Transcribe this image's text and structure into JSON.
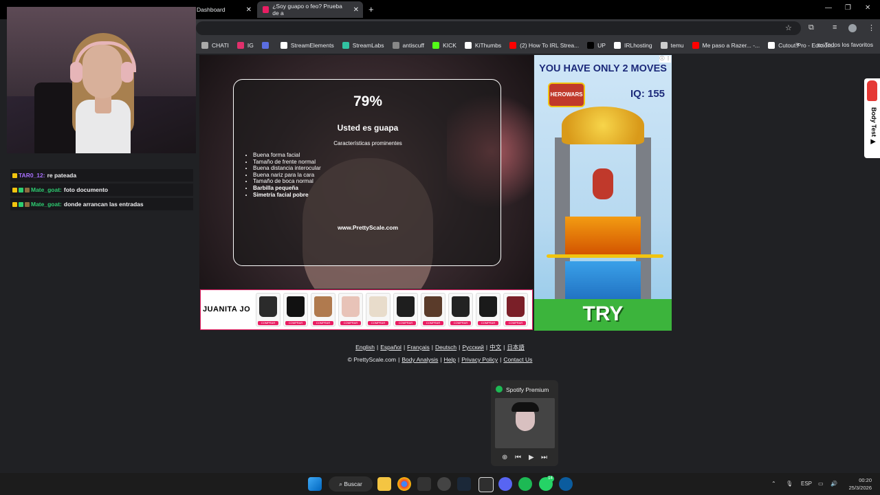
{
  "tabs": [
    {
      "title": "Dashboard"
    },
    {
      "title": "¿Soy guapo o feo? Prueba de a"
    }
  ],
  "bookmarks": [
    {
      "label": "CHATI",
      "color": "#aaaaaa"
    },
    {
      "label": "IG",
      "color": "#e1306c"
    },
    {
      "label": "",
      "color": "#5b6ee1"
    },
    {
      "label": "StreamElements",
      "color": "#ffffff"
    },
    {
      "label": "StreamLabs",
      "color": "#31c3a2"
    },
    {
      "label": "antiscuff",
      "color": "#888888"
    },
    {
      "label": "KICK",
      "color": "#53fc18"
    },
    {
      "label": "KiThumbs",
      "color": "#ffffff"
    },
    {
      "label": "(2) How To IRL Strea...",
      "color": "#ff0000"
    },
    {
      "label": "UP",
      "color": "#000000"
    },
    {
      "label": "IRLhosting",
      "color": "#ffffff"
    },
    {
      "label": "temu",
      "color": "#cccccc"
    },
    {
      "label": "Me paso a Razer... -...",
      "color": "#ff0000"
    },
    {
      "label": "Cutout.Pro - Edición...",
      "color": "#ffffff"
    }
  ],
  "all_favorites": "Todos los favoritos",
  "chat": [
    {
      "user": "TAR0_12:",
      "user_color": "#a970ff",
      "message": "re pateada"
    },
    {
      "user": "Mate_goat:",
      "user_color": "#2ecc71",
      "message": "foto documento"
    },
    {
      "user": "Mate_goat:",
      "user_color": "#2ecc71",
      "message": "donde arrancan las entradas"
    }
  ],
  "result": {
    "percent": "79%",
    "verdict": "Usted es guapa",
    "features_title": "Características prominentes",
    "features": [
      {
        "text": "Buena forma facial",
        "bold": false
      },
      {
        "text": "Tamaño de frente normal",
        "bold": false
      },
      {
        "text": "Buena distancia interocular",
        "bold": false
      },
      {
        "text": "Buena nariz para la cara",
        "bold": false
      },
      {
        "text": "Tamaño de boca normal",
        "bold": false
      },
      {
        "text": "Barbilla pequeña",
        "bold": true
      },
      {
        "text": "Simetría facial pobre",
        "bold": true
      }
    ],
    "site": "www.PrettyScale.com"
  },
  "shop": {
    "brand": "JUANITA JO",
    "buy_label": "COMPRAR",
    "products": [
      {
        "color": "#2b2b2b"
      },
      {
        "color": "#111111"
      },
      {
        "color": "#b07a4e"
      },
      {
        "color": "#e8c3b8"
      },
      {
        "color": "#e8dccb"
      },
      {
        "color": "#1e1e1e"
      },
      {
        "color": "#5a3b2a"
      },
      {
        "color": "#222222"
      },
      {
        "color": "#1a1a1a"
      },
      {
        "color": "#7a1f28"
      }
    ]
  },
  "ad": {
    "headline": "YOU HAVE ONLY 2 MOVES",
    "logo": "HEROWARS",
    "iq": "IQ: 155",
    "cta": "TRY"
  },
  "side_widget": "Body Test ▶",
  "footer": {
    "languages": [
      "English",
      "Español",
      "Français",
      "Deutsch",
      "Русский",
      "中文",
      "日本語"
    ],
    "copyright": "© PrettyScale.com",
    "links": [
      "Body Analysis",
      "Help",
      "Privacy Policy",
      "Contact Us"
    ]
  },
  "spotify": {
    "title": "Spotify Premium"
  },
  "taskbar": {
    "search": "Buscar",
    "badge": "14",
    "lang": "ESP",
    "time": "00:20",
    "date": "25/3/2026"
  }
}
